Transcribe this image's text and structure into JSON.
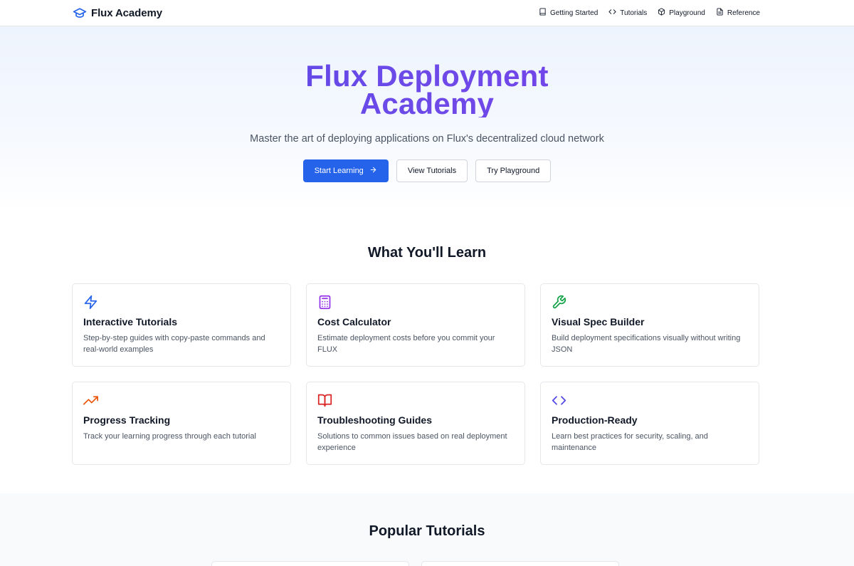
{
  "header": {
    "brand": "Flux Academy",
    "nav": [
      {
        "label": "Getting Started",
        "icon": "book-icon"
      },
      {
        "label": "Tutorials",
        "icon": "code-icon"
      },
      {
        "label": "Playground",
        "icon": "cube-icon"
      },
      {
        "label": "Reference",
        "icon": "document-icon"
      }
    ]
  },
  "hero": {
    "title_line1": "Flux Deployment",
    "title_line2": "Academy",
    "subtitle": "Master the art of deploying applications on Flux's decentralized cloud network",
    "buttons": {
      "start": "Start Learning",
      "tutorials": "View Tutorials",
      "playground": "Try Playground"
    }
  },
  "learn": {
    "title": "What You'll Learn",
    "features": [
      {
        "title": "Interactive Tutorials",
        "desc": "Step-by-step guides with copy-paste commands and real-world examples",
        "icon": "lightning-icon",
        "color": "#2563eb"
      },
      {
        "title": "Cost Calculator",
        "desc": "Estimate deployment costs before you commit your FLUX",
        "icon": "calculator-icon",
        "color": "#9333ea"
      },
      {
        "title": "Visual Spec Builder",
        "desc": "Build deployment specifications visually without writing JSON",
        "icon": "wrench-icon",
        "color": "#16a34a"
      },
      {
        "title": "Progress Tracking",
        "desc": "Track your learning progress through each tutorial",
        "icon": "trending-up-icon",
        "color": "#ea580c"
      },
      {
        "title": "Troubleshooting Guides",
        "desc": "Solutions to common issues based on real deployment experience",
        "icon": "open-book-icon",
        "color": "#dc2626"
      },
      {
        "title": "Production-Ready",
        "desc": "Learn best practices for security, scaling, and maintenance",
        "icon": "code-icon",
        "color": "#4f46e5"
      }
    ]
  },
  "popular": {
    "title": "Popular Tutorials"
  },
  "colors": {
    "primary": "#2563eb",
    "title_gradient_start": "#4f46e5",
    "title_gradient_end": "#7c3aed"
  }
}
